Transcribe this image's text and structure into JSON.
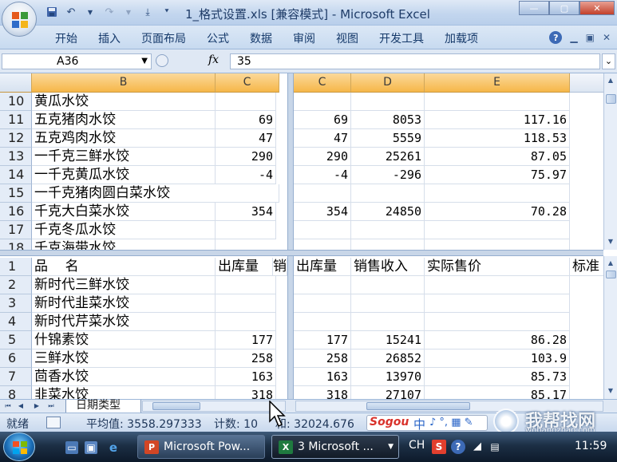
{
  "window": {
    "title": "1_格式设置.xls  [兼容模式] - Microsoft Excel",
    "controls": [
      "—",
      "▢",
      "✕"
    ]
  },
  "quick_access": [
    "save-icon",
    "undo-icon",
    "redo-icon",
    "customize-icon"
  ],
  "ribbon": {
    "tabs": [
      "开始",
      "插入",
      "页面布局",
      "公式",
      "数据",
      "审阅",
      "视图",
      "开发工具",
      "加载项"
    ]
  },
  "formula_bar": {
    "name_box": "A36",
    "fx_label": "fx",
    "formula": "35"
  },
  "top_left_pane": {
    "columns": [
      "B",
      "C"
    ],
    "rows": [
      {
        "row": "10",
        "name": "黄瓜水饺",
        "qty": ""
      },
      {
        "row": "11",
        "name": "五克猪肉水饺",
        "qty": "69"
      },
      {
        "row": "12",
        "name": "五克鸡肉水饺",
        "qty": "47"
      },
      {
        "row": "13",
        "name": "一千克三鲜水饺",
        "qty": "290"
      },
      {
        "row": "14",
        "name": "一千克黄瓜水饺",
        "qty": "-4"
      },
      {
        "row": "15",
        "name": "一千克猪肉圆白菜水饺",
        "qty": ""
      },
      {
        "row": "16",
        "name": "千克大白菜水饺",
        "qty": "354"
      },
      {
        "row": "17",
        "name": "千克冬瓜水饺",
        "qty": ""
      },
      {
        "row": "18",
        "name": "千克海带水饺",
        "qty": ""
      }
    ]
  },
  "top_right_pane": {
    "columns": [
      "C",
      "D",
      "E"
    ],
    "rows": [
      [
        "",
        "",
        ""
      ],
      [
        "69",
        "8053",
        "117.16"
      ],
      [
        "47",
        "5559",
        "118.53"
      ],
      [
        "290",
        "25261",
        "87.05"
      ],
      [
        "-4",
        "-296",
        "75.97"
      ],
      [
        "",
        "",
        ""
      ],
      [
        "354",
        "24850",
        "70.28"
      ],
      [
        "",
        "",
        ""
      ],
      [
        "",
        "",
        ""
      ]
    ]
  },
  "bottom_left_pane": {
    "rows": [
      {
        "row": "1",
        "name": "品    名",
        "qty": "出库量",
        "extra": "销"
      },
      {
        "row": "2",
        "name": "新时代三鲜水饺",
        "qty": "",
        "extra": ""
      },
      {
        "row": "3",
        "name": "新时代韭菜水饺",
        "qty": "",
        "extra": ""
      },
      {
        "row": "4",
        "name": "新时代芹菜水饺",
        "qty": "",
        "extra": ""
      },
      {
        "row": "5",
        "name": "什锦素饺",
        "qty": "177",
        "extra": ""
      },
      {
        "row": "6",
        "name": "三鲜水饺",
        "qty": "258",
        "extra": ""
      },
      {
        "row": "7",
        "name": "茴香水饺",
        "qty": "163",
        "extra": ""
      },
      {
        "row": "8",
        "name": "韭菜水饺",
        "qty": "318",
        "extra": ""
      }
    ]
  },
  "bottom_right_pane": {
    "rows": [
      [
        "出库量",
        "销售收入",
        "实际售价",
        "标准"
      ],
      [
        "",
        "",
        "",
        ""
      ],
      [
        "",
        "",
        "",
        ""
      ],
      [
        "",
        "",
        "",
        ""
      ],
      [
        "177",
        "15241",
        "86.28",
        ""
      ],
      [
        "258",
        "26852",
        "103.9",
        ""
      ],
      [
        "163",
        "13970",
        "85.73",
        ""
      ],
      [
        "318",
        "27107",
        "85.17",
        ""
      ]
    ]
  },
  "sheet_tabs": {
    "active": "日期类型"
  },
  "status_bar": {
    "ready": "就绪",
    "average": "平均值: 3558.297333",
    "count": "计数: 10",
    "sum": "和: 32024.676",
    "ime_brand": "Sogou",
    "ime_mode": "中",
    "ime_extra": "♪ °, ▦ ✎"
  },
  "watermark": {
    "text": "我帮找网",
    "sub": "wobangzhao.com"
  },
  "taskbar": {
    "tasks": [
      "Microsoft Pow...",
      "3 Microsoft ..."
    ],
    "lang": "CH",
    "clock": "11:59"
  }
}
